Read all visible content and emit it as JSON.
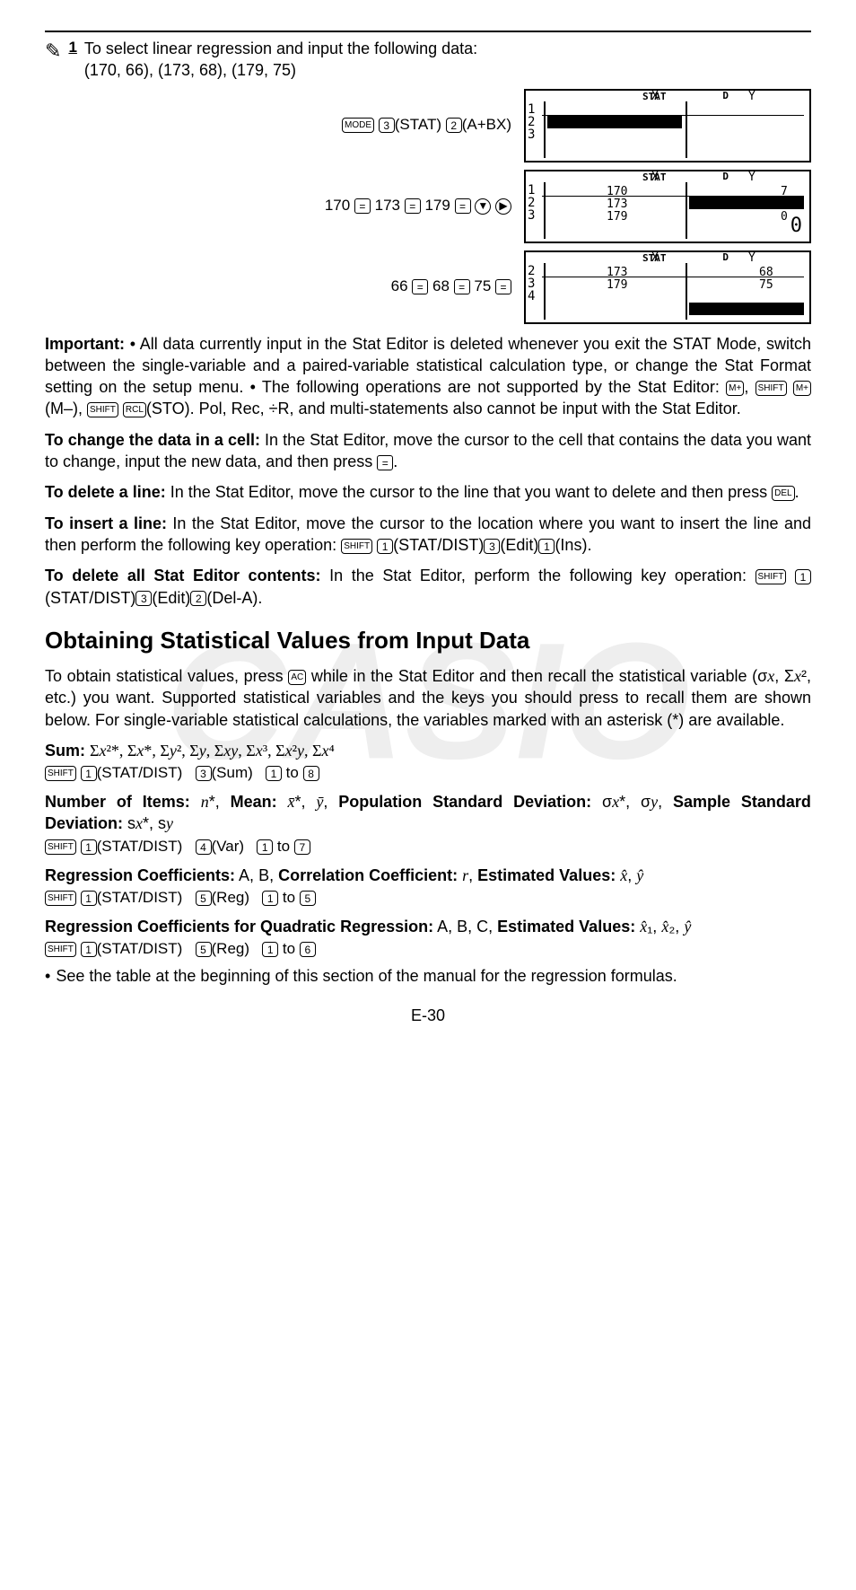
{
  "page_number": "E-30",
  "step": {
    "number": "1",
    "text": "To select linear regression and input the following data:",
    "data_line": "(170, 66), (173, 68), (179, 75)"
  },
  "kv": {
    "row1_keys": "MODE 3 (STAT) 2 (A+BX)",
    "row2_keys": "170 = 173 = 179 = ▼ ▶",
    "row3_keys": "66 = 68 = 75 ="
  },
  "lcd": {
    "stat": "STAT",
    "d": "D",
    "colX": "X",
    "colY": "Y",
    "rows1": "1\n2\n3",
    "rows2": "1\n2\n3",
    "rows3": "2\n3\n4",
    "x2": "170\n173\n179",
    "y2": "7\n0\n0",
    "x3": "173\n179",
    "y3": "68\n75",
    "big2": "0"
  },
  "important": {
    "label": "Important:",
    "text1": " • All data currently input in the Stat Editor is deleted whenever you exit the STAT Mode, switch between the single-variable and a paired-variable statistical calculation type, or change the Stat Format setting on the setup menu. • The following operations are not supported by the Stat Editor: ",
    "text2": "(M–), ",
    "text3": "(STO). Pol, Rec, ÷R, and multi-statements also cannot be input with the Stat Editor."
  },
  "change_cell": {
    "label": "To change the data in a cell:",
    "text": " In the Stat Editor, move the cursor to the cell that contains the data you want to change, input the new data, and then press "
  },
  "delete_line": {
    "label": "To delete a line:",
    "text": " In the Stat Editor, move the cursor to the line that you want to delete and then press "
  },
  "insert_line": {
    "label": "To insert a line:",
    "text": " In the Stat Editor, move the cursor to the location where you want to insert the line and then perform the following key operation: ",
    "keys": "(STAT/DIST) 3 (Edit) 1 (Ins)."
  },
  "delete_all": {
    "label": "To delete all Stat Editor contents:",
    "text": " In the Stat Editor, perform the following key operation: ",
    "keys": "(STAT/DIST) 3 (Edit) 2 (Del-A)."
  },
  "subhead": "Obtaining Statistical Values from Input Data",
  "obtain_text": "To obtain statistical values, press AC while in the Stat Editor and then recall the statistical variable (σx, Σx², etc.) you want. Supported statistical variables and the keys you should press to recall them are shown below. For single-variable statistical calculations, the variables marked with an asterisk (*) are available.",
  "sum": {
    "label": "Sum:",
    "vars": " Σx²*, Σx*, Σy², Σy, Σxy, Σx³, Σx²y, Σx⁴",
    "keys": "(STAT/DIST)   3 (Sum)   1  to  8"
  },
  "number": {
    "label1": "Number of Items:",
    "v1": " n*, ",
    "label2": "Mean:",
    "v2": " x̄*, ȳ, ",
    "label3": "Population Standard Deviation:",
    "v3": " σx*, σy, ",
    "label4": "Sample Standard Deviation:",
    "v4": " sx*, sy",
    "keys": "(STAT/DIST)   4 (Var)   1  to  7"
  },
  "reg": {
    "label1": "Regression Coefficients:",
    "v1": " A, B, ",
    "label2": "Correlation Coefficient:",
    "v2": " r, ",
    "label3": "Estimated Values:",
    "v3": " x̂, ŷ",
    "keys": "(STAT/DIST)   5 (Reg)   1  to  5"
  },
  "quad": {
    "label1": "Regression Coefficients for Quadratic Regression:",
    "v1": " A, B, C, ",
    "label2": "Estimated Values:",
    "v2": " x̂₁, x̂₂, ŷ",
    "keys": "(STAT/DIST)   5 (Reg)   1  to  6"
  },
  "bullet": "See the table at the beginning of this section of the manual for the regression formulas.",
  "keys": {
    "mode": "MODE",
    "shift": "SHIFT",
    "mplus": "M+",
    "rcl": "RCL",
    "del": "DEL",
    "ac": "AC",
    "exe": "=",
    "k1": "1",
    "k2": "2",
    "k3": "3",
    "k4": "4",
    "k5": "5",
    "k6": "6",
    "k7": "7",
    "k8": "8"
  }
}
